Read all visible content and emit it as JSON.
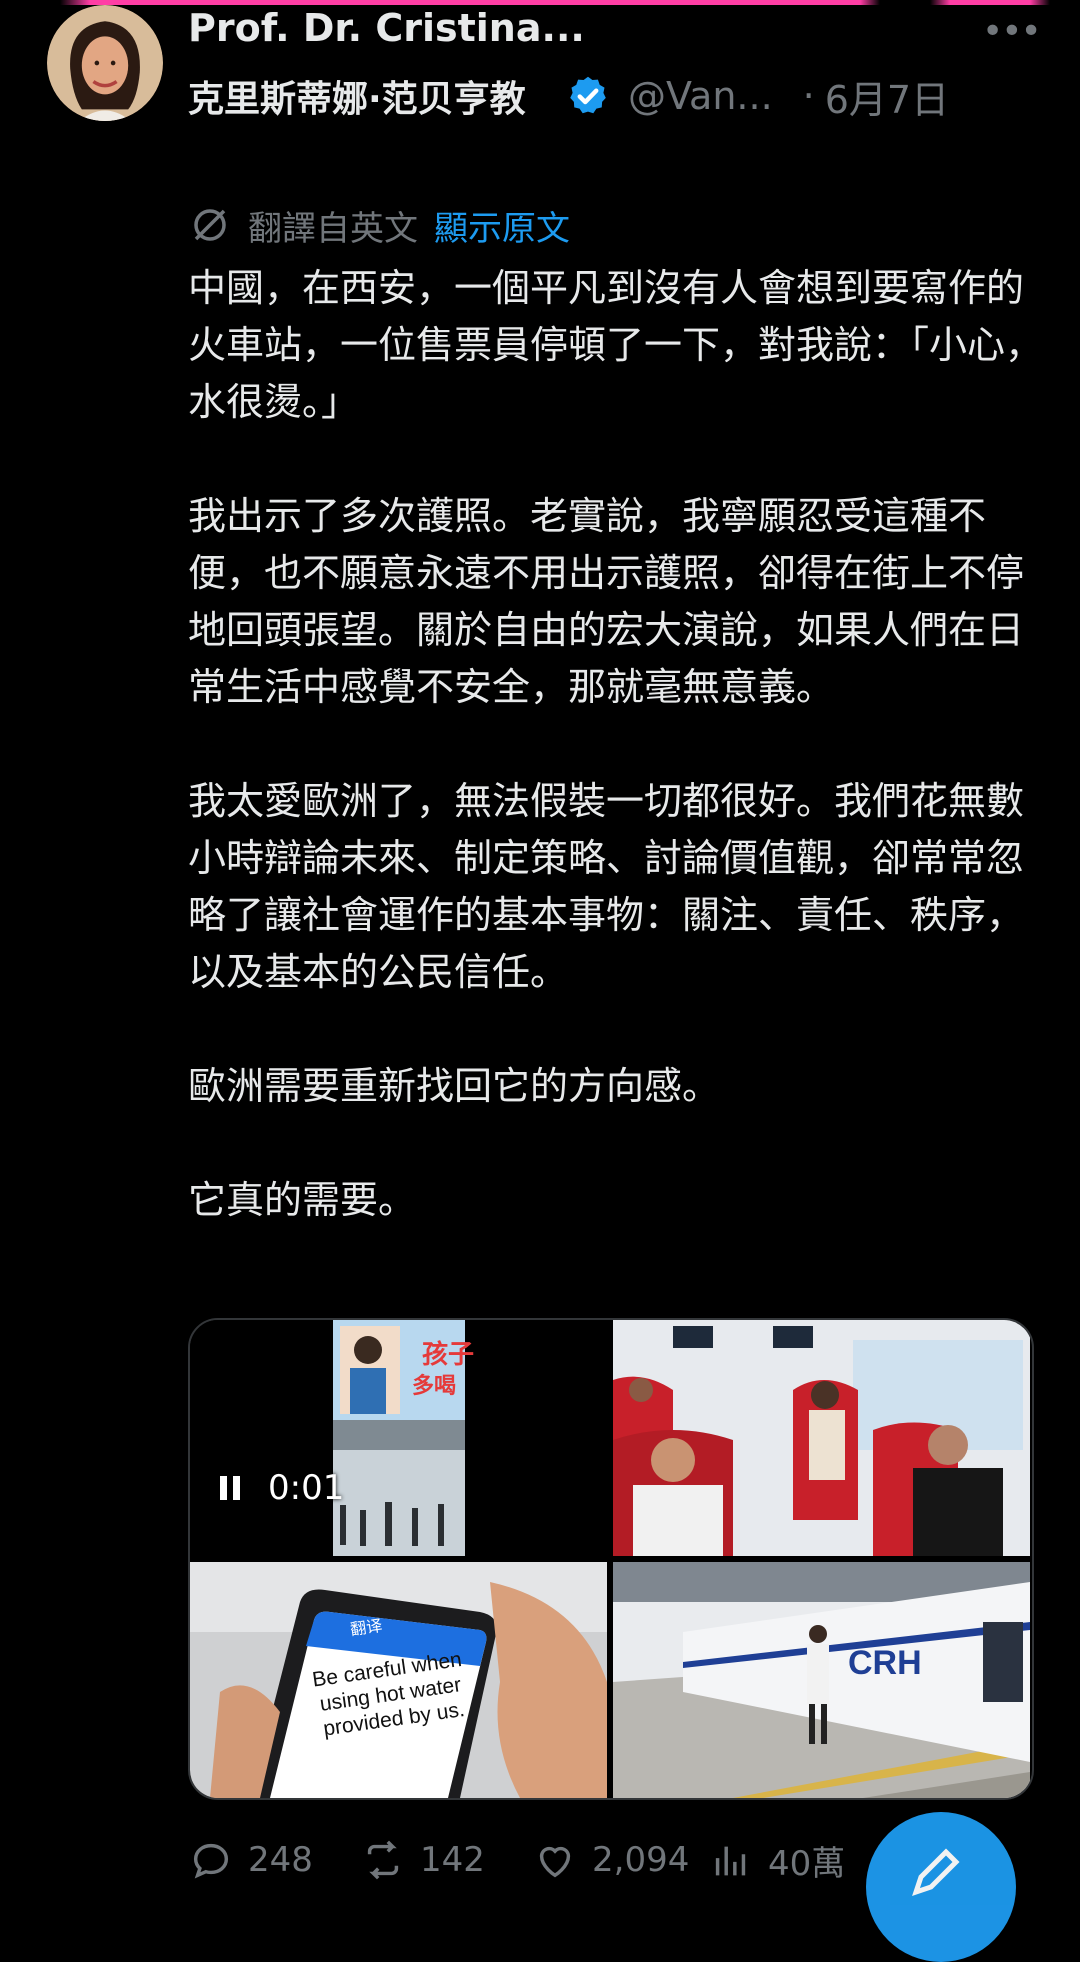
{
  "author": {
    "name": "Prof. Dr. Cristina...",
    "cn_name": "克里斯蒂娜·范贝亨教",
    "handle": "@Van...",
    "separator": "·",
    "date": "6月7日",
    "verified_icon": "verified-badge-icon"
  },
  "translation": {
    "label": "翻譯自英文",
    "show_original": "顯示原文"
  },
  "body": {
    "paragraphs": [
      "中國，在西安，一個平凡到沒有人會想到要寫作的火車站，一位售票員停頓了一下，對我說：「小心，水很燙。」",
      "我出示了多次護照。老實說，我寧願忍受這種不便，也不願意永遠不用出示護照，卻得在街上不停地回頭張望。關於自由的宏大演說，如果人們在日常生活中感覺不安全，那就毫無意義。",
      "我太愛歐洲了，無法假裝一切都很好。我們花無數小時辯論未來、制定策略、討論價值觀，卻常常忽略了讓社會運作的基本事物：關注、責任、秩序，以及基本的公民信任。",
      "歐洲需要重新找回它的方向感。",
      "它真的需要。"
    ]
  },
  "media": {
    "video_time": "0:01",
    "poster_text_1": "孩子",
    "poster_text_2": "多喝",
    "phone_header": "翻译",
    "phone_text": "Be careful when using hot water provided by us.",
    "train_text": "CRH"
  },
  "actions": {
    "replies": "248",
    "retweets": "142",
    "likes": "2,094",
    "views": "40萬"
  },
  "colors": {
    "accent": "#1d9bf0",
    "text": "#e7e9ea",
    "muted": "#71767b",
    "background": "#000000",
    "top_bar": "#ff3ea5"
  }
}
